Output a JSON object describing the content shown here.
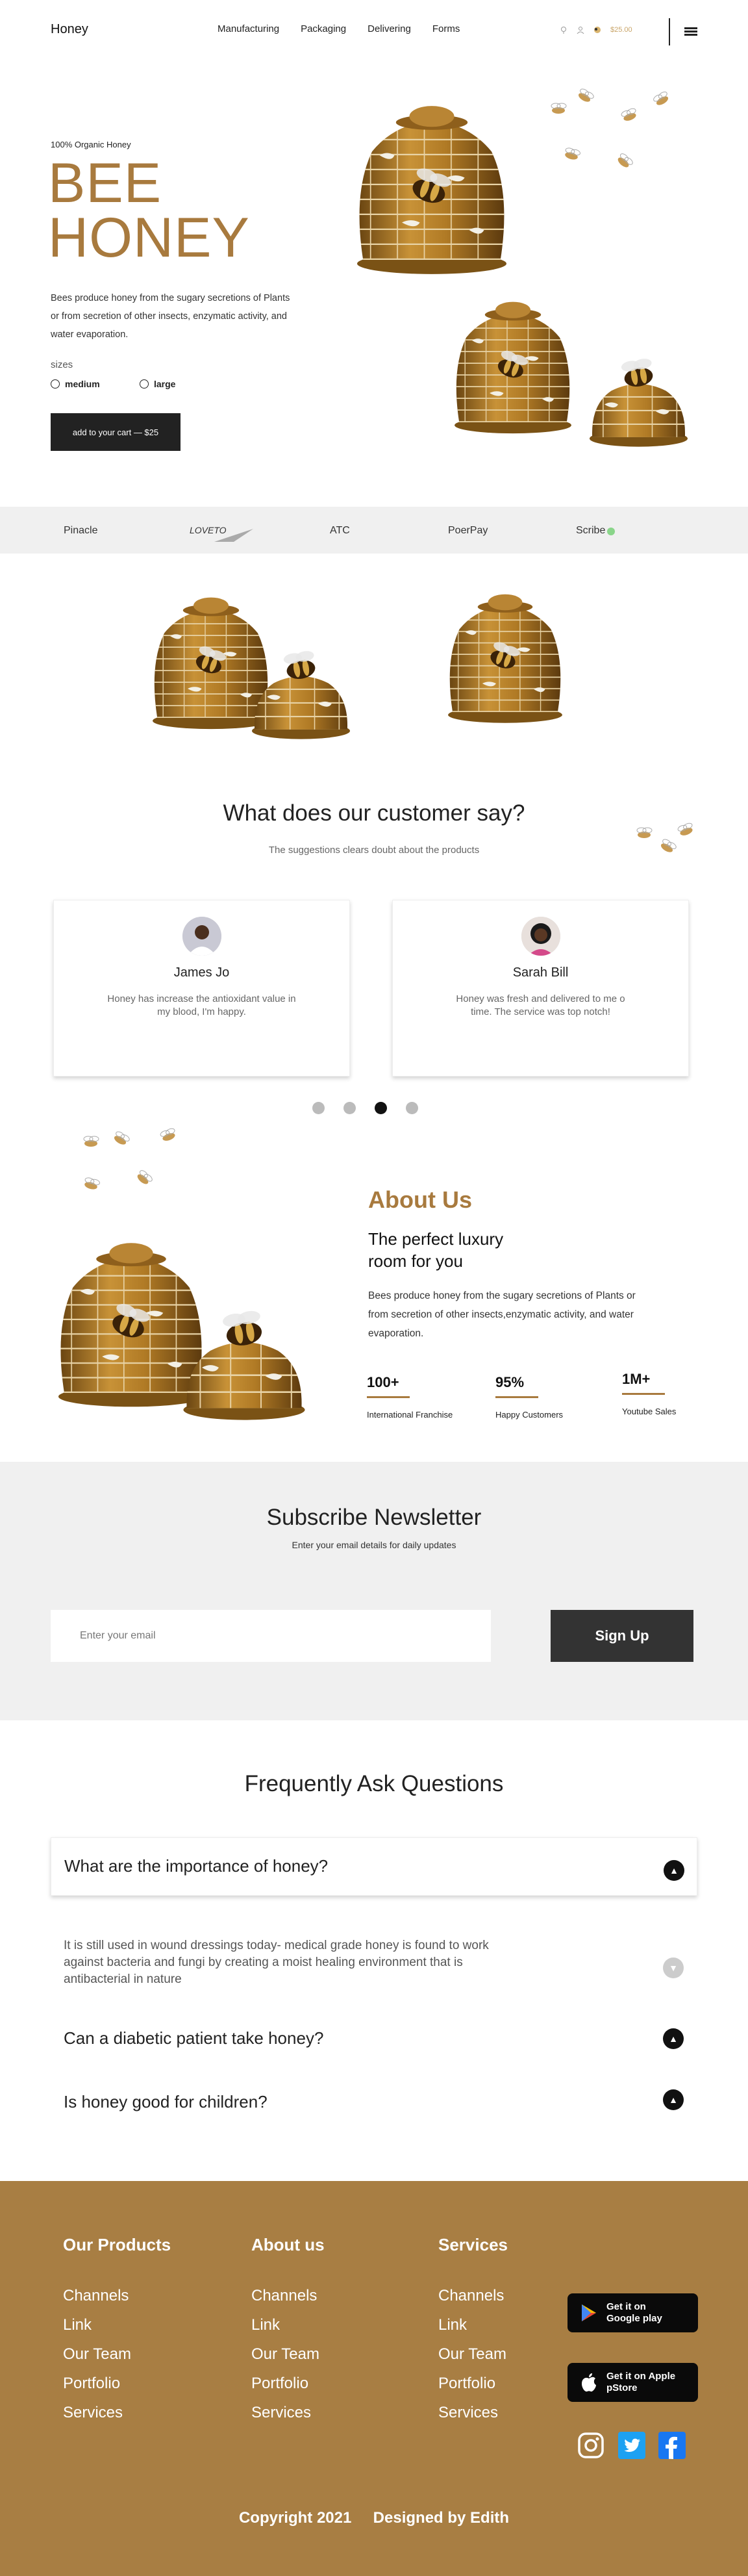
{
  "nav": {
    "logo": "Honey",
    "links": [
      "Manufacturing",
      "Packaging",
      "Delivering",
      "Forms"
    ],
    "cart_price": "$25.00"
  },
  "hero": {
    "kicker": "100% Organic Honey",
    "title_line1": "BEE",
    "title_line2": "HONEY",
    "description": "Bees produce honey from the  sugary secretions of Plants or from secretion of other insects, enzymatic activity, and  water evaporation.",
    "sizes_label": "sizes",
    "size_options": [
      "medium",
      "large"
    ],
    "cart_button": "add to your cart — $25"
  },
  "brands": [
    "Pinacle",
    "LOVETO",
    "ATC",
    "PoerPay",
    "Scribe"
  ],
  "testimonials": {
    "title": "What does our customer say?",
    "subtitle": "The suggestions clears doubt about the products",
    "cards": [
      {
        "name": "James Jo",
        "quote": "Honey has increase  the antioxidant value in my blood,  I'm happy."
      },
      {
        "name": "Sarah Bill",
        "quote": "Honey  was fresh  and  delivered to me o time. The service was top notch!"
      }
    ],
    "active_dot": 3
  },
  "about": {
    "title": "About Us",
    "subtitle": "The perfect luxury room for you",
    "description": "Bees produce honey from the  sugary secretions of Plants or from secretion of other insects,enzymatic activity, and  water evaporation.",
    "stats": [
      {
        "value": "100+",
        "label": "International Franchise"
      },
      {
        "value": "95%",
        "label": "Happy  Customers"
      },
      {
        "value": "1M+",
        "label": "Youtube Sales"
      }
    ]
  },
  "newsletter": {
    "title": "Subscribe Newsletter",
    "subtitle": "Enter your email details for daily updates",
    "placeholder": "Enter your email",
    "button": "Sign Up"
  },
  "faq": {
    "title": "Frequently Ask Questions",
    "q1": "What are the importance of honey?",
    "answer": "It is still used in wound dressings today- medical grade honey is found to work against bacteria and fungi by creating a moist healing environment that is antibacterial in nature",
    "q2": "Can a diabetic patient take honey?",
    "q3": "Is honey good for children?"
  },
  "footer": {
    "columns": [
      {
        "heading": "Our Products",
        "links": [
          "Channels",
          "Link",
          "Our Team",
          "Portfolio",
          "Services"
        ]
      },
      {
        "heading": "About us",
        "links": [
          "Channels",
          "Link",
          "Our Team",
          "Portfolio",
          "Services"
        ]
      },
      {
        "heading": "Services",
        "links": [
          "Channels",
          "Link",
          "Our Team",
          "Portfolio",
          "Services"
        ]
      }
    ],
    "google_play": "Get it on Google play",
    "app_store": "Get it on Apple pStore",
    "copyright": "Copyright 2021     Designed by Edith"
  },
  "colors": {
    "accent": "#a87a3e",
    "footer": "#a87e43",
    "dark": "#222222"
  }
}
